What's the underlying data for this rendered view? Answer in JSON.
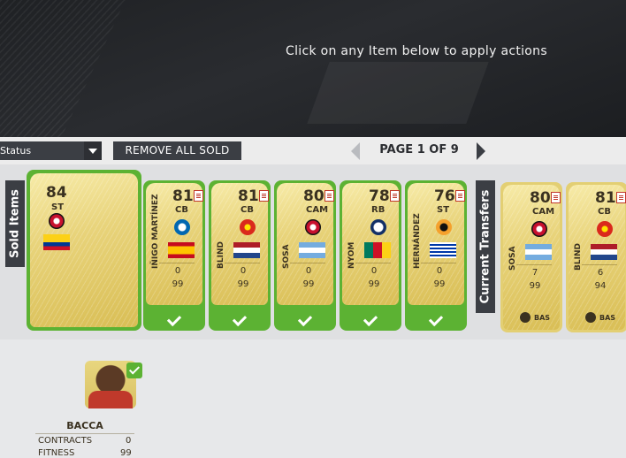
{
  "banner": {
    "message": "Click on any Item below to apply actions"
  },
  "toolbar": {
    "status_value": "Status",
    "remove_label": "REMOVE ALL SOLD",
    "page_label": "PAGE 1 OF 9"
  },
  "sections": {
    "sold": "Sold Items",
    "current": "Current Transfers"
  },
  "featured": {
    "rating": "84",
    "position": "ST",
    "name": "BACCA",
    "contracts_label": "CONTRACTS",
    "contracts": "0",
    "fitness_label": "FITNESS",
    "fitness": "99",
    "flag": "colombia",
    "club": "ac-milan"
  },
  "sold_cards": [
    {
      "rating": "81",
      "position": "CB",
      "name": "IÑIGO MARTÍNEZ",
      "contracts": "0",
      "fitness": "99",
      "flag": "spain",
      "club": "real-sociedad"
    },
    {
      "rating": "81",
      "position": "CB",
      "name": "BLIND",
      "contracts": "0",
      "fitness": "99",
      "flag": "netherlands",
      "club": "manchester-united"
    },
    {
      "rating": "80",
      "position": "CAM",
      "name": "SOSA",
      "contracts": "0",
      "fitness": "99",
      "flag": "argentina",
      "club": "ac-milan"
    },
    {
      "rating": "78",
      "position": "RB",
      "name": "NYOM",
      "contracts": "0",
      "fitness": "99",
      "flag": "cameroon",
      "club": "west-brom"
    },
    {
      "rating": "76",
      "position": "ST",
      "name": "HERNÁNDEZ",
      "contracts": "0",
      "fitness": "99",
      "flag": "uruguay",
      "club": "hull-city"
    }
  ],
  "current_cards": [
    {
      "rating": "80",
      "position": "CAM",
      "name": "SOSA",
      "contracts": "7",
      "fitness": "99",
      "flag": "argentina",
      "club": "ac-milan",
      "chem": "BAS"
    },
    {
      "rating": "81",
      "position": "CB",
      "name": "BLIND",
      "contracts": "6",
      "fitness": "94",
      "flag": "netherlands",
      "club": "manchester-united",
      "chem": "BAS"
    }
  ],
  "colors": {
    "accent_green": "#5cb233",
    "dark_button": "#3b3e44",
    "gold": "#e8d37a"
  }
}
